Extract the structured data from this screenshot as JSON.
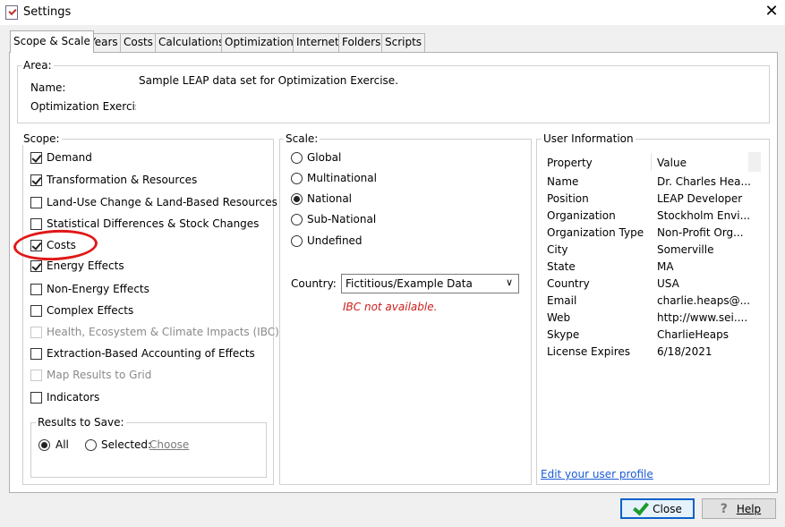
{
  "window": {
    "title": "Settings"
  },
  "tabs": [
    {
      "label": "Scope & Scale",
      "active": true
    },
    {
      "label": "Years"
    },
    {
      "label": "Costs"
    },
    {
      "label": "Calculations"
    },
    {
      "label": "Optimization"
    },
    {
      "label": "Internet"
    },
    {
      "label": "Folders"
    },
    {
      "label": "Scripts"
    }
  ],
  "area": {
    "legend": "Area:",
    "name_label": "Name:",
    "name_value": "Optimization Exercise",
    "description": "Sample LEAP data set for Optimization Exercise."
  },
  "scope": {
    "legend": "Scope:",
    "items": [
      {
        "label": "Demand",
        "checked": true
      },
      {
        "label": "Transformation & Resources",
        "checked": true
      },
      {
        "label": "Land-Use Change & Land-Based Resources",
        "checked": false
      },
      {
        "label": "Statistical Differences & Stock Changes",
        "checked": false
      },
      {
        "label": "Costs",
        "checked": true
      },
      {
        "label": "Energy Effects",
        "checked": true
      },
      {
        "label": "Non-Energy Effects",
        "checked": false
      },
      {
        "label": "Complex Effects",
        "checked": false
      },
      {
        "label": "Health, Ecosystem & Climate Impacts (IBC)",
        "checked": false,
        "disabled": true
      },
      {
        "label": "Extraction-Based Accounting of Effects",
        "checked": false
      },
      {
        "label": "Map Results to Grid",
        "checked": false,
        "disabled": true
      },
      {
        "label": "Indicators",
        "checked": false
      }
    ],
    "results": {
      "legend": "Results to Save:",
      "all_label": "All",
      "selected_label": "Selected:",
      "choose_link": "Choose",
      "selected": "All"
    }
  },
  "scale": {
    "legend": "Scale:",
    "options": [
      "Global",
      "Multinational",
      "National",
      "Sub-National",
      "Undefined"
    ],
    "selected": "National",
    "country_label": "Country:",
    "country_value": "Fictitious/Example Data",
    "warning": "IBC not available."
  },
  "user_info": {
    "legend": "User Information",
    "headers": {
      "property": "Property",
      "value": "Value"
    },
    "rows": [
      {
        "property": "Name",
        "value": "Dr. Charles Hea..."
      },
      {
        "property": "Position",
        "value": "LEAP Developer"
      },
      {
        "property": "Organization",
        "value": "Stockholm Envi..."
      },
      {
        "property": "Organization Type",
        "value": "Non-Profit Org..."
      },
      {
        "property": "City",
        "value": "Somerville"
      },
      {
        "property": "State",
        "value": "MA"
      },
      {
        "property": "Country",
        "value": "USA"
      },
      {
        "property": "Email",
        "value": "charlie.heaps@..."
      },
      {
        "property": "Web",
        "value": "http://www.sei...."
      },
      {
        "property": "Skype",
        "value": "CharlieHeaps"
      },
      {
        "property": "License Expires",
        "value": "6/18/2021"
      }
    ],
    "edit_link": "Edit your user profile"
  },
  "buttons": {
    "close": "Close",
    "help": "Help"
  },
  "colors": {
    "annotation": "#e01818",
    "link": "#1a5bd4",
    "warning": "#cc2020"
  }
}
